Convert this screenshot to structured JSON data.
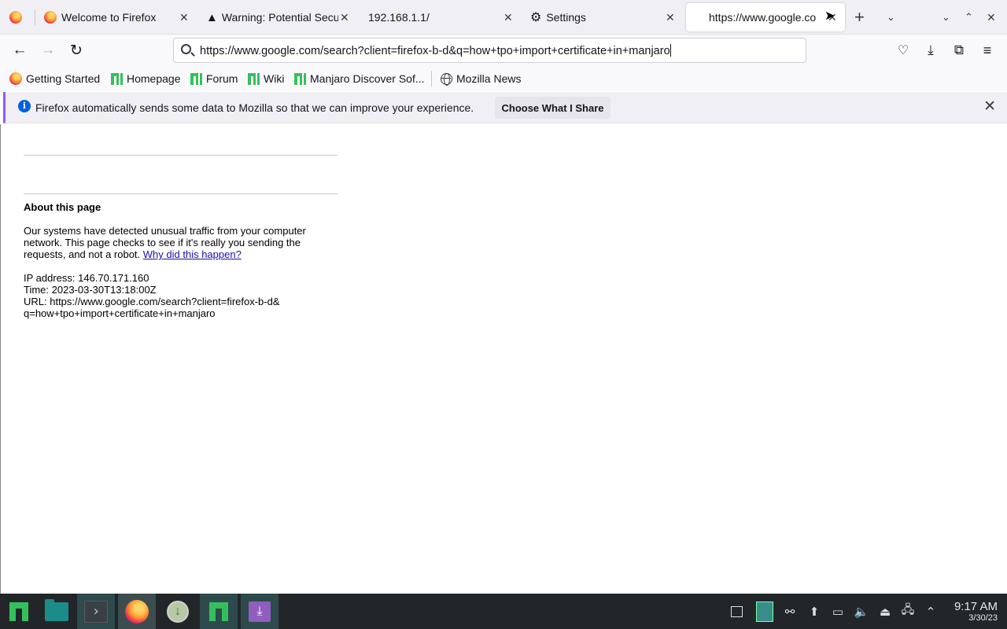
{
  "tabs": [
    {
      "title": "Welcome to Firefox",
      "icon": "firefox-icon"
    },
    {
      "title": "Warning: Potential Secu",
      "icon": "warning-icon"
    },
    {
      "title": "192.168.1.1/",
      "icon": ""
    },
    {
      "title": "Settings",
      "icon": "gear-icon"
    },
    {
      "title": "https://www.google.co",
      "icon": "",
      "active": true
    }
  ],
  "nav": {
    "url": "https://www.google.com/search?client=firefox-b-d&q=how+tpo+import+certificate+in+manjaro"
  },
  "bookmarks": [
    {
      "label": "Getting Started",
      "icon": "firefox-icon"
    },
    {
      "label": "Homepage",
      "icon": "manjaro-icon"
    },
    {
      "label": "Forum",
      "icon": "manjaro-icon"
    },
    {
      "label": "Wiki",
      "icon": "manjaro-icon"
    },
    {
      "label": "Manjaro Discover Sof...",
      "icon": "manjaro-icon"
    },
    {
      "label": "Mozilla News",
      "icon": "globe-icon"
    }
  ],
  "notification": {
    "message": "Firefox automatically sends some data to Mozilla so that we can improve your experience.",
    "button": "Choose What I Share"
  },
  "page": {
    "about_title": "About this page",
    "paragraph": "Our systems have detected unusual traffic from your computer network. This page checks to see if it's really you sending the requests, and not a robot.",
    "link": "Why did this happen?",
    "ip": "IP address: 146.70.171.160",
    "time": "Time: 2023-03-30T13:18:00Z",
    "url_line1": "URL: https://www.google.com/search?client=firefox-b-d&",
    "url_line2": "q=how+tpo+import+certificate+in+manjaro"
  },
  "taskbar": {
    "time": "9:17 AM",
    "date": "3/30/23"
  }
}
